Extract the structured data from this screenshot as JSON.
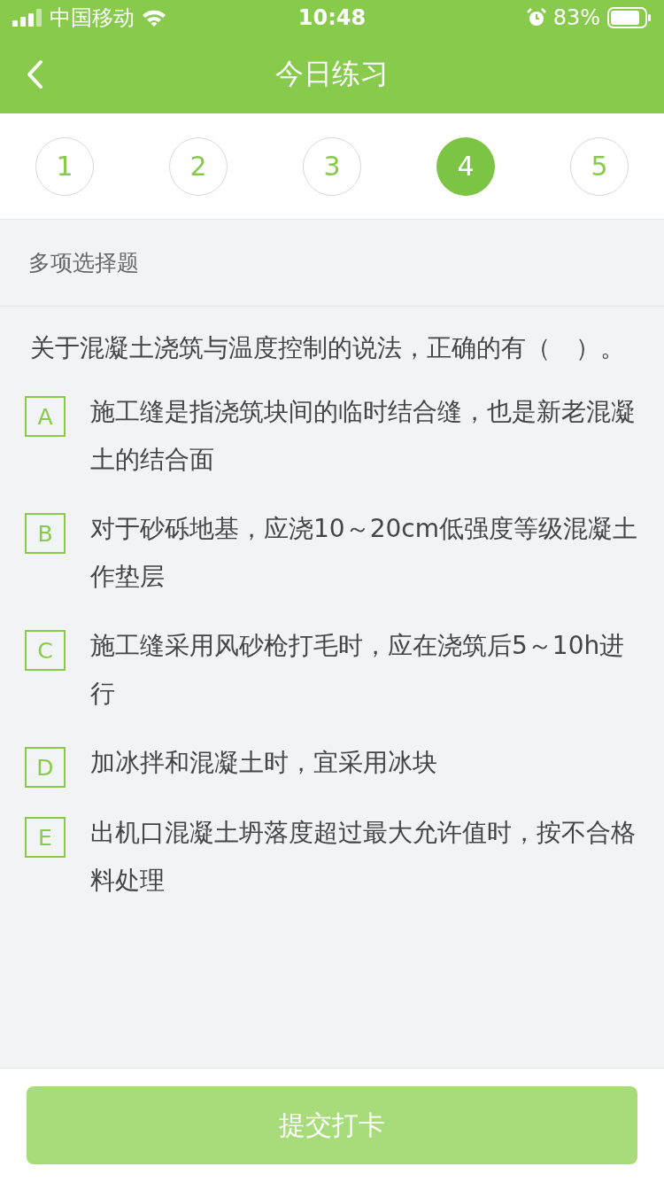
{
  "status_bar": {
    "carrier": "中国移动",
    "time": "10:48",
    "battery": "83%"
  },
  "nav": {
    "title": "今日练习"
  },
  "question_numbers": [
    {
      "label": "1",
      "selected": false
    },
    {
      "label": "2",
      "selected": false
    },
    {
      "label": "3",
      "selected": false
    },
    {
      "label": "4",
      "selected": true
    },
    {
      "label": "5",
      "selected": false
    }
  ],
  "question_type": "多项选择题",
  "question": "关于混凝土浇筑与温度控制的说法，正确的有（　）。",
  "options": [
    {
      "letter": "A",
      "text": "施工缝是指浇筑块间的临时结合缝，也是新老混凝土的结合面",
      "selected": false
    },
    {
      "letter": "B",
      "text": "对于砂砾地基，应浇10～20cm低强度等级混凝土作垫层",
      "selected": false
    },
    {
      "letter": "C",
      "text": "施工缝采用风砂枪打毛时，应在浇筑后5～10h进行",
      "selected": false
    },
    {
      "letter": "D",
      "text": "加冰拌和混凝土时，宜采用冰块",
      "selected": false
    },
    {
      "letter": "E",
      "text": "出机口混凝土坍落度超过最大允许值时，按不合格料处理",
      "selected": false
    }
  ],
  "submit": {
    "label": "提交打卡",
    "disabled": true
  }
}
